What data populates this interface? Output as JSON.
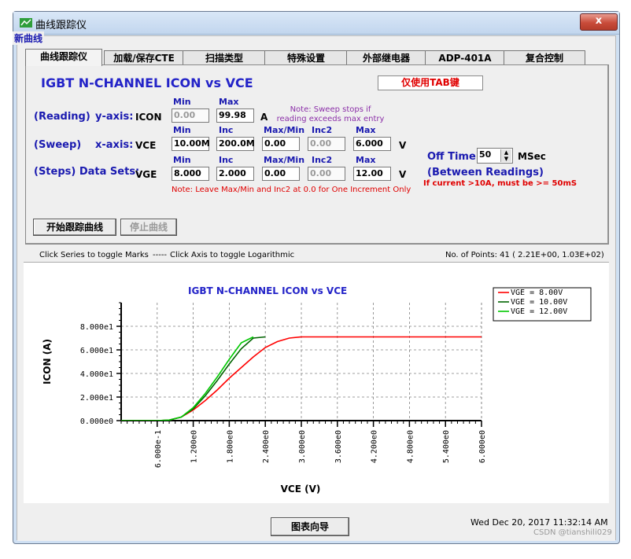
{
  "window": {
    "title": "曲线跟踪仪",
    "close_label": "x"
  },
  "group_label": "新曲线",
  "tabs": [
    "曲线跟踪仪",
    "加载/保存CTE",
    "扫描类型",
    "特殊设置",
    "外部继电器",
    "ADP-401A",
    "复合控制"
  ],
  "panel": {
    "heading": "IGBT N-CHANNEL ICON vs VCE",
    "tab_key_label": "仅使用TAB键",
    "reading": {
      "label": "(Reading)",
      "axis": "y-axis:",
      "param": "ICON",
      "min_header": "Min",
      "max_header": "Max",
      "min_value": "0.00",
      "max_value": "99.98",
      "unit": "A",
      "note_line1": "Note:  Sweep stops if",
      "note_line2": "reading exceeds max entry"
    },
    "sweep": {
      "label": "(Sweep)",
      "axis": "x-axis:",
      "param": "VCE",
      "headers": [
        "Min",
        "Inc",
        "Max/Min",
        "Inc2",
        "Max"
      ],
      "values": [
        "10.00M",
        "200.0M",
        "0.00",
        "0.00",
        "6.000"
      ],
      "unit": "V"
    },
    "steps": {
      "label": "(Steps) Data Sets:",
      "param": "VGE",
      "headers": [
        "Min",
        "Inc",
        "Max/Min",
        "Inc2",
        "Max"
      ],
      "values": [
        "8.000",
        "2.000",
        "0.00",
        "0.00",
        "12.00"
      ],
      "unit": "V",
      "note": "Note: Leave Max/Min and Inc2 at 0.0 for One Increment Only"
    },
    "off_time": {
      "label": "Off Time:",
      "value": "50",
      "unit": "MSec",
      "between": "(Between Readings)",
      "warning": "If current >10A, must be >= 50mS"
    },
    "start_button": "开始跟踪曲线",
    "stop_button": "停止曲线"
  },
  "status": {
    "left": "Click Series to toggle Marks",
    "dashes": "-----",
    "middle": "Click Axis to  toggle Logarithmic",
    "right": "No. of Points: 41 ( 2.21E+00, 1.03E+02)"
  },
  "chart_data": {
    "type": "line",
    "title": "IGBT N-CHANNEL ICON vs VCE",
    "xlabel": "VCE (V)",
    "ylabel": "ICON (A)",
    "xlim": [
      0.0,
      6.0
    ],
    "ylim": [
      0,
      100
    ],
    "xticks": [
      "6.000e-1",
      "1.200e0",
      "1.800e0",
      "2.400e0",
      "3.000e0",
      "3.600e0",
      "4.200e0",
      "4.800e0",
      "5.400e0",
      "6.000e0"
    ],
    "yticks": [
      "0.000e0",
      "2.000e1",
      "4.000e1",
      "6.000e1",
      "8.000e1"
    ],
    "grid": true,
    "legend_position": "top-right",
    "series": [
      {
        "name": "VGE =  8.00V",
        "color": "#ff0000",
        "x": [
          0.0,
          0.6,
          0.8,
          1.0,
          1.2,
          1.4,
          1.6,
          1.8,
          2.0,
          2.2,
          2.4,
          2.6,
          2.8,
          3.0,
          6.0
        ],
        "y": [
          0,
          0,
          0.5,
          3,
          9,
          17,
          26,
          36,
          45,
          54,
          62,
          67,
          70,
          71,
          71
        ]
      },
      {
        "name": "VGE = 10.00V",
        "color": "#006400",
        "x": [
          0.0,
          0.6,
          0.8,
          1.0,
          1.2,
          1.4,
          1.6,
          1.8,
          2.0,
          2.2,
          2.4
        ],
        "y": [
          0,
          0,
          0.5,
          3,
          10,
          21,
          34,
          48,
          61,
          70,
          71
        ]
      },
      {
        "name": "VGE = 12.00V",
        "color": "#00c800",
        "x": [
          0.0,
          0.6,
          0.8,
          1.0,
          1.2,
          1.4,
          1.6,
          1.8,
          2.0,
          2.2
        ],
        "y": [
          0,
          0,
          0.5,
          3,
          11,
          23,
          37,
          52,
          66,
          71
        ]
      }
    ]
  },
  "bottom": {
    "chart_wizard_button": "图表向导",
    "datetime": "Wed Dec 20, 2017  11:32:14 AM"
  },
  "watermark": "CSDN @tianshili029"
}
